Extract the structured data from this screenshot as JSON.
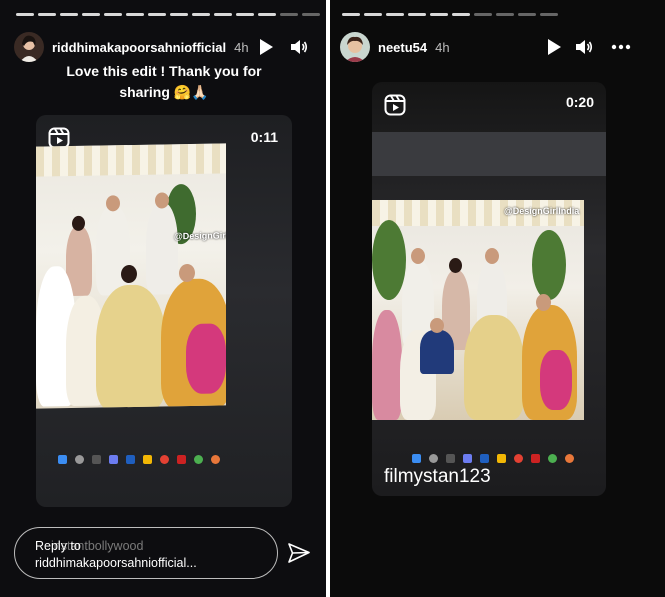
{
  "left_story": {
    "progress_total": 14,
    "progress_viewed": 12,
    "username": "riddhimakapoorsahniofficial",
    "time": "4h",
    "caption": "Love this edit ! Thank you for sharing 🤗🙏🏻",
    "reel": {
      "duration": "0:11",
      "watermark": "@DesignGirlIndia"
    },
    "reply": {
      "line1": "Reply to",
      "line2": "riddhimakapoorsahniofficial...",
      "ghost_text": "instantbollywood"
    },
    "icons": [
      "play-icon",
      "volume-icon",
      "send-icon",
      "reels-icon"
    ]
  },
  "right_story": {
    "progress_total": 10,
    "progress_viewed": 6,
    "username": "neetu54",
    "time": "4h",
    "reel": {
      "duration": "0:20",
      "watermark": "@DesignGirlIndia",
      "overlay_text": "filmystan123"
    },
    "icons": [
      "play-icon",
      "volume-icon",
      "more-icon",
      "reels-icon"
    ]
  },
  "colors": {
    "background": "#0c0c0e",
    "text": "#ffffff",
    "muted": "#bdbdbd",
    "progress_active": "#d8d8d8",
    "progress_inactive": "#666666"
  }
}
